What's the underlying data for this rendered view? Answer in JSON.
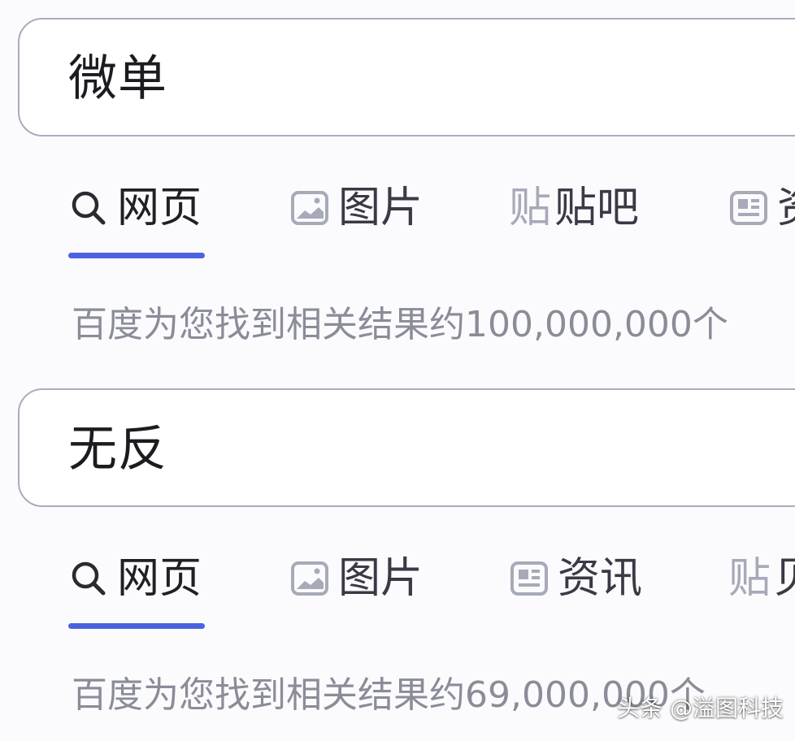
{
  "colors": {
    "accent": "#4b62e0",
    "border": "#a9acbc",
    "icon": "#a7aab8",
    "count_text": "#8a8c98"
  },
  "panels": [
    {
      "query": "微单",
      "tabs": [
        {
          "label": "网页",
          "icon": "search-icon",
          "active": true
        },
        {
          "label": "图片",
          "icon": "image-icon",
          "active": false
        },
        {
          "label": "贴吧",
          "icon": "tieba-icon",
          "active": false
        },
        {
          "label": "资",
          "icon": "news-icon",
          "active": false
        }
      ],
      "result_count": "百度为您找到相关结果约100,000,000个"
    },
    {
      "query": "无反",
      "tabs": [
        {
          "label": "网页",
          "icon": "search-icon",
          "active": true
        },
        {
          "label": "图片",
          "icon": "image-icon",
          "active": false
        },
        {
          "label": "资讯",
          "icon": "news-icon",
          "active": false
        },
        {
          "label": "贝",
          "icon": "tieba-icon",
          "active": false
        }
      ],
      "result_count": "百度为您找到相关结果约69,000,000个"
    }
  ],
  "watermark": "头条 @溢图科技"
}
